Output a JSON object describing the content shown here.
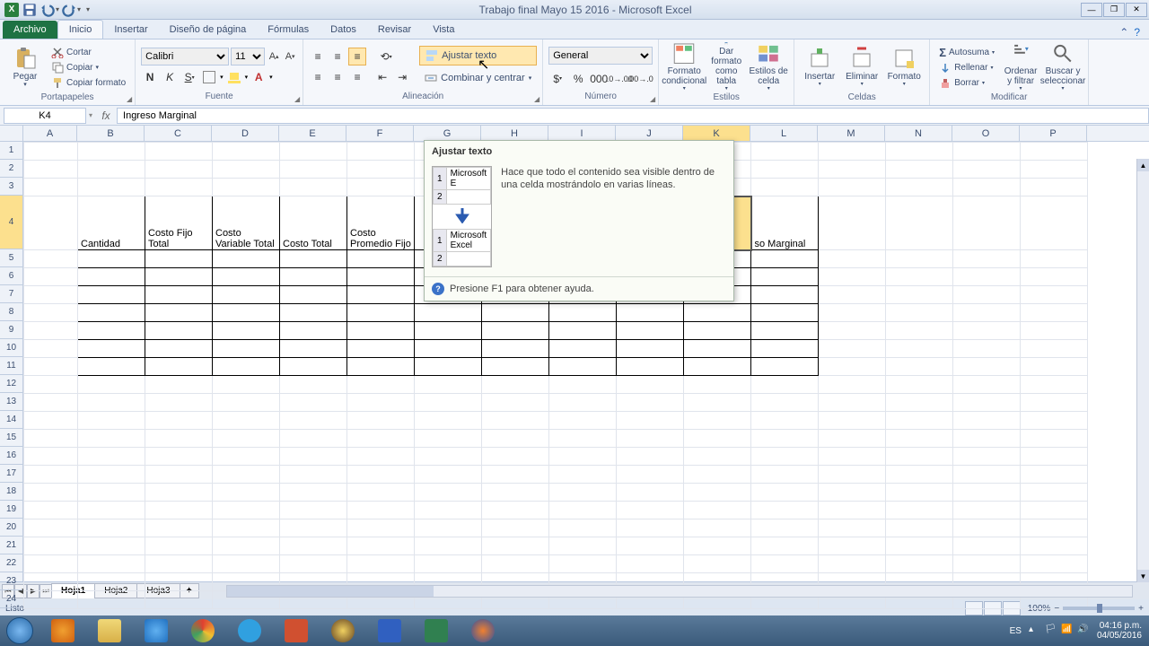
{
  "title": "Trabajo final Mayo 15 2016 - Microsoft Excel",
  "tabs": {
    "file": "Archivo",
    "items": [
      "Inicio",
      "Insertar",
      "Diseño de página",
      "Fórmulas",
      "Datos",
      "Revisar",
      "Vista"
    ],
    "active": "Inicio"
  },
  "ribbon": {
    "clipboard": {
      "label": "Portapapeles",
      "paste": "Pegar",
      "cut": "Cortar",
      "copy": "Copiar",
      "format_painter": "Copiar formato"
    },
    "font": {
      "label": "Fuente",
      "name": "Calibri",
      "size": "11"
    },
    "alignment": {
      "label": "Alineación",
      "wrap": "Ajustar texto",
      "merge": "Combinar y centrar"
    },
    "number": {
      "label": "Número",
      "format": "General"
    },
    "styles": {
      "label": "Estilos",
      "cond": "Formato condicional",
      "table": "Dar formato como tabla",
      "cell": "Estilos de celda"
    },
    "cells": {
      "label": "Celdas",
      "insert": "Insertar",
      "delete": "Eliminar",
      "format": "Formato"
    },
    "editing": {
      "label": "Modificar",
      "autosum": "Autosuma",
      "fill": "Rellenar",
      "clear": "Borrar",
      "sort": "Ordenar y filtrar",
      "find": "Buscar y seleccionar"
    }
  },
  "formula": {
    "name_box": "K4",
    "value": "Ingreso Marginal"
  },
  "columns": [
    "A",
    "B",
    "C",
    "D",
    "E",
    "F",
    "G",
    "H",
    "I",
    "J",
    "K",
    "L",
    "M",
    "N",
    "O",
    "P"
  ],
  "selected_col": "K",
  "rows": 24,
  "selected_row": 4,
  "table_headers": [
    "Cantidad",
    "Costo Fijo Total",
    "Costo Variable Total",
    "Costo Total",
    "Costo Promedio Fijo",
    "",
    "",
    "",
    "",
    "",
    "so Marginal"
  ],
  "tooltip": {
    "title": "Ajustar texto",
    "example_before": "Microsoft E",
    "example_after_1": "Microsoft",
    "example_after_2": "Excel",
    "desc": "Hace que todo el contenido sea visible dentro de una celda mostrándolo en varias líneas.",
    "help": "Presione F1 para obtener ayuda."
  },
  "sheets": {
    "items": [
      "Hoja1",
      "Hoja2",
      "Hoja3"
    ],
    "active": "Hoja1"
  },
  "status": {
    "ready": "Listo",
    "zoom": "100%"
  },
  "tray": {
    "lang": "ES",
    "time": "04:16 p.m.",
    "date": "04/05/2016"
  }
}
